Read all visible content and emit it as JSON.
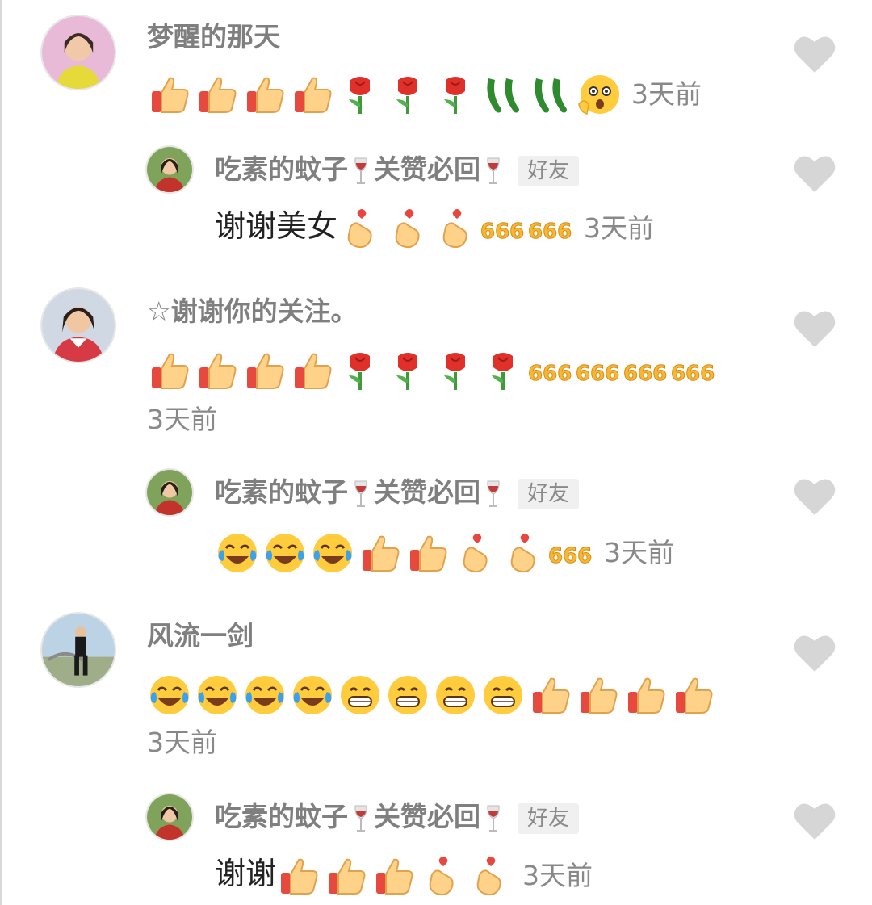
{
  "comments": [
    {
      "name": "梦醒的那天",
      "emojis": [
        "thumbs-up",
        "thumbs-up",
        "thumbs-up",
        "thumbs-up",
        "rose",
        "rose",
        "rose",
        "cucumber",
        "cucumber",
        "shocked-face"
      ],
      "time": "3天前",
      "reply": {
        "name": "吃素的蚊子",
        "name_sep": "关赞必回",
        "badge": "好友",
        "text": "谢谢美女",
        "emojis": [
          "heart-fingers",
          "heart-fingers",
          "heart-fingers",
          "666",
          "666"
        ],
        "time": "3天前"
      }
    },
    {
      "name": "☆谢谢你的关注。",
      "emojis": [
        "thumbs-up",
        "thumbs-up",
        "thumbs-up",
        "thumbs-up",
        "rose",
        "rose",
        "rose",
        "rose",
        "666",
        "666",
        "666",
        "666"
      ],
      "time": "3天前",
      "reply": {
        "name": "吃素的蚊子",
        "name_sep": "关赞必回",
        "badge": "好友",
        "text": "",
        "emojis": [
          "laugh-cry",
          "laugh-cry",
          "laugh-cry",
          "thumbs-up",
          "thumbs-up",
          "heart-fingers",
          "heart-fingers",
          "666"
        ],
        "time": "3天前"
      }
    },
    {
      "name": "风流一剑",
      "emojis": [
        "laugh-cry",
        "laugh-cry",
        "laugh-cry",
        "laugh-cry",
        "grin",
        "grin",
        "grin",
        "grin",
        "thumbs-up",
        "thumbs-up",
        "thumbs-up",
        "thumbs-up"
      ],
      "time": "3天前",
      "reply": {
        "name": "吃素的蚊子",
        "name_sep": "关赞必回",
        "badge": "好友",
        "text": "谢谢",
        "emojis": [
          "thumbs-up",
          "thumbs-up",
          "thumbs-up",
          "heart-fingers",
          "heart-fingers"
        ],
        "time": "3天前"
      }
    }
  ],
  "colors": {
    "name_gray": "#7f7f7f",
    "time_gray": "#888888",
    "heart_gray": "#d6d6d6",
    "badge_bg": "#f0f0f0"
  }
}
